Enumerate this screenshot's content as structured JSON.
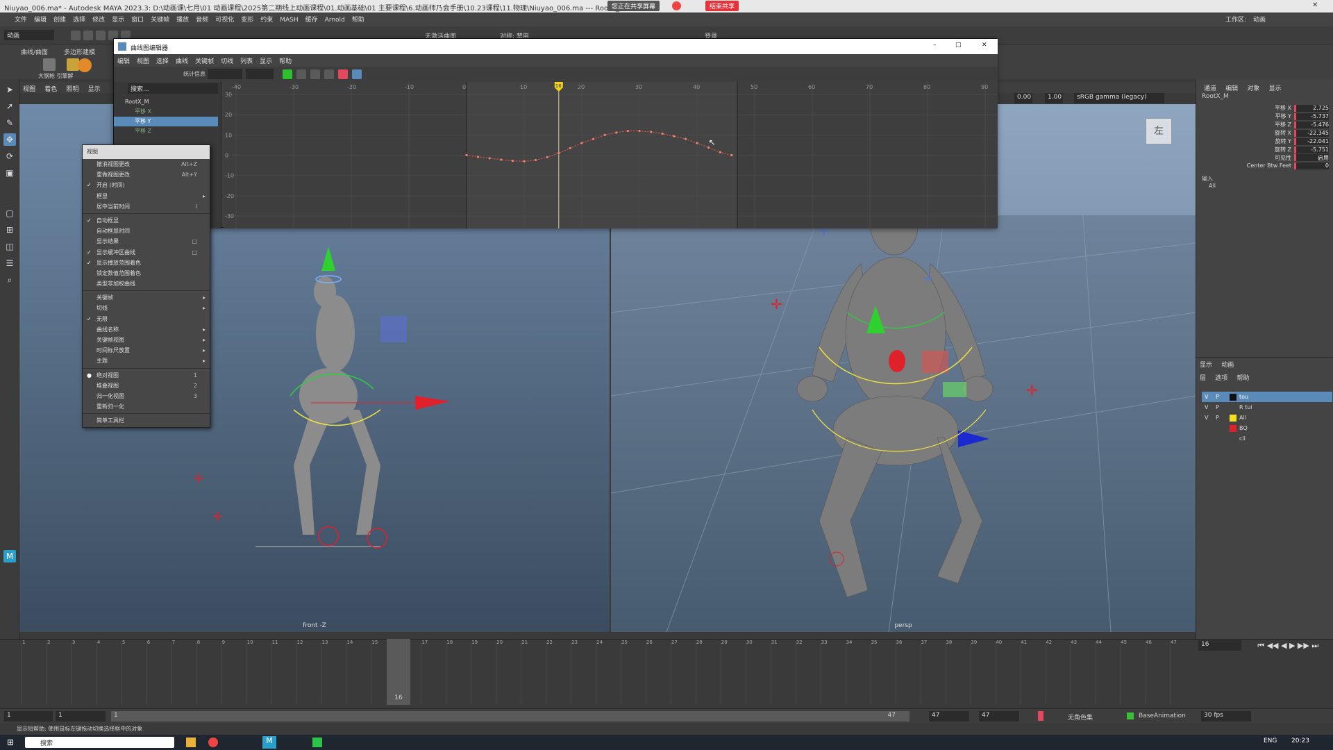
{
  "window": {
    "title": "Niuyao_006.ma* - Autodesk MAYA 2023.3: D:\\动画课\\七月\\01 动画课程\\2025第二期线上动画课程\\01.动画基础\\01 主要课程\\6.动画师乃会手册\\10.23课程\\11.物理\\Niuyao_006.ma --- RootX_M",
    "sharing_label": "您正在共享屏幕",
    "stop_sharing_label": "结束共享"
  },
  "menu": {
    "items": [
      "文件",
      "编辑",
      "创建",
      "选择",
      "修改",
      "显示",
      "窗口",
      "关键帧",
      "播放",
      "音频",
      "可视化",
      "变形",
      "约束",
      "MASH",
      "缓存",
      "Arnold",
      "帮助"
    ],
    "workspace_label": "工作区:",
    "workspace_value": "动画"
  },
  "status_line": {
    "mode_value": "动画",
    "no_live_surface": "无激活曲面",
    "symmetry_label": "对称: 禁用",
    "login_label": "登录"
  },
  "shelf": {
    "tabs": [
      "曲线/曲面",
      "多边形建模"
    ],
    "icon_labels": [
      "大钢枪 引擎解"
    ]
  },
  "graph_editor": {
    "title": "曲线图编辑器",
    "menu": [
      "编辑",
      "视图",
      "选择",
      "曲线",
      "关键帧",
      "切线",
      "列表",
      "显示",
      "帮助"
    ],
    "stats_label": "统计信息",
    "search_placeholder": "搜索...",
    "outliner_items": [
      {
        "label": "RootX_M",
        "selected": false
      },
      {
        "label": "平移 X",
        "selected": false
      },
      {
        "label": "平移 Y",
        "selected": true
      },
      {
        "label": "平移 Z",
        "selected": false
      }
    ],
    "x_ticks": [
      "-40",
      "-30",
      "-20",
      "-10",
      "0",
      "10",
      "20",
      "30",
      "40",
      "50",
      "60",
      "70",
      "80",
      "90"
    ],
    "y_ticks": [
      "30",
      "20",
      "10",
      "0",
      "-10",
      "-20",
      "-30"
    ],
    "current_frame_marker": "16",
    "curve": {
      "frames": [
        0,
        2,
        4,
        6,
        8,
        10,
        12,
        14,
        16,
        18,
        20,
        22,
        24,
        26,
        28,
        30,
        32,
        34,
        36,
        38,
        40,
        42,
        44,
        46
      ],
      "values": [
        0,
        -0.8,
        -1.5,
        -2.2,
        -2.8,
        -3,
        -2.4,
        -1,
        1,
        3.5,
        6,
        8,
        10,
        11.2,
        12,
        12,
        11.5,
        10.6,
        9.4,
        8,
        6,
        3.8,
        1.5,
        0
      ]
    },
    "window_buttons": [
      "–",
      "□",
      "✕"
    ]
  },
  "context_menu": {
    "header": "视图",
    "items": [
      {
        "label": "撤消视图更改",
        "shortcut": "Alt+Z",
        "check": "",
        "arrow": false
      },
      {
        "label": "重做视图更改",
        "shortcut": "Alt+Y",
        "check": "",
        "arrow": false
      },
      {
        "label": "开启 (时间)",
        "shortcut": "",
        "check": "✓",
        "arrow": false
      },
      {
        "label": "框显",
        "shortcut": "",
        "check": "",
        "arrow": true
      },
      {
        "label": "居中当前时间",
        "shortcut": "I",
        "check": "",
        "arrow": false
      },
      {
        "sep": true
      },
      {
        "label": "自动框显",
        "shortcut": "",
        "check": "✓",
        "arrow": false
      },
      {
        "label": "自动框显时间",
        "shortcut": "",
        "check": "",
        "arrow": false
      },
      {
        "label": "显示结果",
        "shortcut": "□",
        "check": "",
        "arrow": false
      },
      {
        "label": "显示缓冲区曲线",
        "shortcut": "□",
        "check": "✓",
        "arrow": false
      },
      {
        "label": "显示播放范围着色",
        "shortcut": "",
        "check": "✓",
        "arrow": false
      },
      {
        "label": "锁定数值范围着色",
        "shortcut": "",
        "check": "",
        "arrow": false
      },
      {
        "label": "类型非加权曲线",
        "shortcut": "",
        "check": "",
        "arrow": false
      },
      {
        "sep": true
      },
      {
        "label": "关键帧",
        "shortcut": "",
        "check": "",
        "arrow": true
      },
      {
        "label": "切线",
        "shortcut": "",
        "check": "",
        "arrow": true
      },
      {
        "label": "无限",
        "shortcut": "",
        "check": "✓",
        "arrow": false
      },
      {
        "label": "曲线名称",
        "shortcut": "",
        "check": "",
        "arrow": true
      },
      {
        "label": "关键帧视图",
        "shortcut": "",
        "check": "",
        "arrow": true
      },
      {
        "label": "时间标尺放置",
        "shortcut": "",
        "check": "",
        "arrow": true
      },
      {
        "label": "主题",
        "shortcut": "",
        "check": "",
        "arrow": true
      },
      {
        "sep": true
      },
      {
        "label": "绝对视图",
        "shortcut": "1",
        "check": "●",
        "arrow": false
      },
      {
        "label": "堆叠视图",
        "shortcut": "2",
        "check": "",
        "arrow": false
      },
      {
        "label": "归一化视图",
        "shortcut": "3",
        "check": "",
        "arrow": false
      },
      {
        "label": "重新归一化",
        "shortcut": "",
        "check": "",
        "arrow": false
      },
      {
        "sep": true
      },
      {
        "label": "简单工具栏",
        "shortcut": "",
        "check": "",
        "arrow": false
      }
    ]
  },
  "panel_menu": [
    "视图",
    "着色",
    "照明",
    "显示"
  ],
  "viewport_left": {
    "label": "front -Z"
  },
  "viewport_right": {
    "label": "persp",
    "viewcube_label": "左",
    "exposure": "0.00",
    "gamma": "1.00",
    "color_space": "sRGB gamma (legacy)"
  },
  "channel_box": {
    "tabs": [
      "通道",
      "编辑",
      "对象",
      "显示"
    ],
    "object_name": "RootX_M",
    "attributes": [
      {
        "name": "平移 X",
        "value": "2.725"
      },
      {
        "name": "平移 Y",
        "value": "-5.737"
      },
      {
        "name": "平移 Z",
        "value": "-5.476"
      },
      {
        "name": "旋转 X",
        "value": "-22.345"
      },
      {
        "name": "旋转 Y",
        "value": "-22.041"
      },
      {
        "name": "旋转 Z",
        "value": "-5.751"
      },
      {
        "name": "可见性",
        "value": "启用"
      },
      {
        "name": "Center Btw Feet",
        "value": "0"
      }
    ],
    "inputs_label": "输入",
    "inputs_value": "All"
  },
  "layer_editor": {
    "tabs": [
      "显示",
      "动画"
    ],
    "menu": [
      "层",
      "选项",
      "帮助"
    ],
    "layers": [
      {
        "v": "V",
        "p": "P",
        "name": "tou",
        "color": "#111111",
        "selected": true
      },
      {
        "v": "V",
        "p": "P",
        "name": "R tui",
        "color": "#444444",
        "selected": false
      },
      {
        "v": "V",
        "p": "P",
        "name": "All",
        "color": "#f2e01a",
        "selected": false
      },
      {
        "v": "",
        "p": "",
        "name": "BQ",
        "color": "#e0202a",
        "selected": false
      },
      {
        "v": "",
        "p": "",
        "name": "cii",
        "color": "#444444",
        "selected": false
      }
    ]
  },
  "timeline": {
    "ticks": [
      "1",
      "2",
      "3",
      "4",
      "5",
      "6",
      "7",
      "8",
      "9",
      "10",
      "11",
      "12",
      "13",
      "14",
      "15",
      "16",
      "17",
      "18",
      "19",
      "20",
      "21",
      "22",
      "23",
      "24",
      "25",
      "26",
      "27",
      "28",
      "29",
      "30",
      "31",
      "32",
      "33",
      "34",
      "35",
      "36",
      "37",
      "38",
      "39",
      "40",
      "41",
      "42",
      "43",
      "44",
      "45",
      "46",
      "47"
    ],
    "current_frame": "16",
    "current_frame_field": "16"
  },
  "range": {
    "start": "1",
    "inner_start": "1",
    "inner_end": "47",
    "end": "47",
    "end2": "47",
    "char_set": "无角色集",
    "anim_layer": "BaseAnimation",
    "fps": "30 fps"
  },
  "command_line": {
    "help_text": "显示短帮助; 使用鼠标左键拖动切换选择框中的对象"
  },
  "taskbar": {
    "search_placeholder": "搜索",
    "lang": "ENG",
    "time": "20:23"
  },
  "colors": {
    "accent": "#5a8ab8",
    "key": "#e2485e",
    "curve": "#d8594a"
  }
}
